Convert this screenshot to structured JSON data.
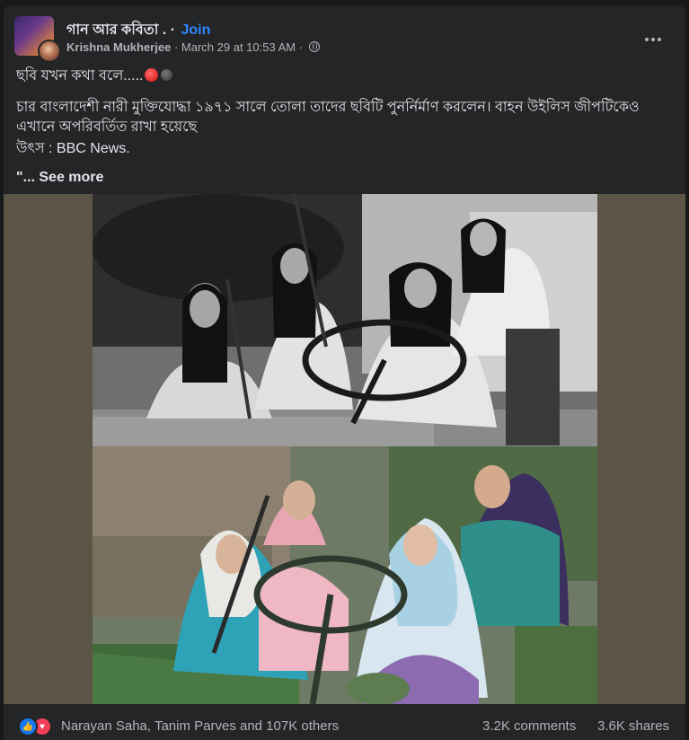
{
  "header": {
    "group_name": "গান আর কবিতা .",
    "separator": "·",
    "join_label": "Join",
    "author": "Krishna Mukherjee",
    "meta_sep": "·",
    "timestamp": "March 29 at 10:53 AM",
    "meta_sep2": "·",
    "privacy_icon": "globe-icon",
    "more_icon": "more-options-icon"
  },
  "post": {
    "line1": "ছবি যখন কথা বলে.....",
    "line2": "চার বাংলাদেশী নারী মুক্তিযোদ্ধা ১৯৭১ সালে তোলা তাদের ছবিটি পুনর্নির্মাণ করলেন। বাহন উইলিস জীপটিকেও এখানে অপরিবর্তিত রাখা হয়েছে",
    "line3": "উৎস : BBC News.",
    "quote": "\"...",
    "see_more": "See more"
  },
  "reactions": {
    "like_icon": "like-icon",
    "love_icon": "love-icon",
    "reactors_text": "Narayan Saha, Tanim Parves and 107K others",
    "comments": "3.2K comments",
    "shares": "3.6K shares"
  },
  "colors": {
    "background": "#18191a",
    "card": "#242526",
    "text": "#e4e6eb",
    "secondary": "#b0b3b8",
    "link": "#2d88ff"
  }
}
